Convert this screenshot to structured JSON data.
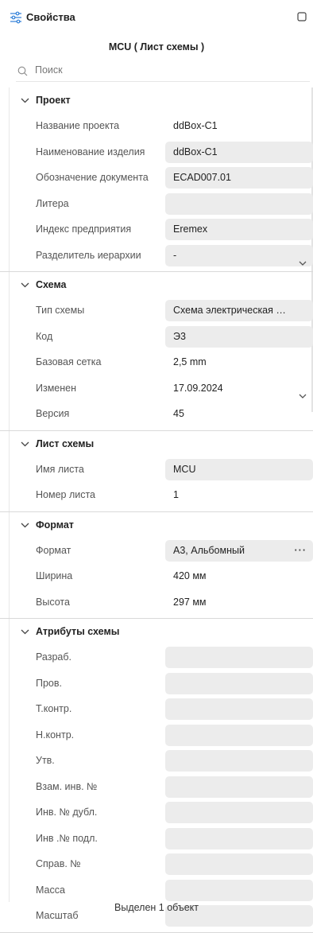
{
  "header": {
    "title": "Свойства",
    "icon": "sliders-icon",
    "pin_icon": "square-icon"
  },
  "sheet_title": "MCU ( Лист схемы )",
  "search": {
    "placeholder": "Поиск",
    "value": ""
  },
  "sections": [
    {
      "title": "Проект",
      "rows": [
        {
          "name": "Название проекта",
          "value": "ddBox-C1",
          "style": "plain"
        },
        {
          "name": "Наименование изделия",
          "value": "ddBox-C1",
          "style": "filled"
        },
        {
          "name": "Обозначение документа",
          "value": "ECAD007.01",
          "style": "filled"
        },
        {
          "name": "Литера",
          "value": "",
          "style": "filled"
        },
        {
          "name": "Индекс предприятия",
          "value": "Eremex",
          "style": "filled"
        },
        {
          "name": "Разделитель иерархии",
          "value": "-",
          "style": "filled",
          "control": "dropdown"
        }
      ]
    },
    {
      "title": "Схема",
      "rows": [
        {
          "name": "Тип схемы",
          "value": "Схема электрическая при...",
          "style": "filled"
        },
        {
          "name": "Код",
          "value": "Э3",
          "style": "filled"
        },
        {
          "name": "Базовая сетка",
          "value": "2,5 mm",
          "style": "plain"
        },
        {
          "name": "Изменен",
          "value": "17.09.2024",
          "style": "plain",
          "control": "dropdown"
        },
        {
          "name": "Версия",
          "value": "45",
          "style": "plain"
        }
      ]
    },
    {
      "title": "Лист схемы",
      "rows": [
        {
          "name": "Имя листа",
          "value": "MCU",
          "style": "filled"
        },
        {
          "name": "Номер листа",
          "value": "1",
          "style": "plain"
        }
      ]
    },
    {
      "title": "Формат",
      "rows": [
        {
          "name": "Формат",
          "value": "А3, Альбомный",
          "style": "filled",
          "control": "ellipsis"
        },
        {
          "name": "Ширина",
          "value": "420 мм",
          "style": "plain"
        },
        {
          "name": "Высота",
          "value": "297 мм",
          "style": "plain"
        }
      ]
    },
    {
      "title": "Атрибуты схемы",
      "rows": [
        {
          "name": "Разраб.",
          "value": "",
          "style": "filled"
        },
        {
          "name": "Пров.",
          "value": "",
          "style": "filled"
        },
        {
          "name": "Т.контр.",
          "value": "",
          "style": "filled"
        },
        {
          "name": "Н.контр.",
          "value": "",
          "style": "filled"
        },
        {
          "name": "Утв.",
          "value": "",
          "style": "filled"
        },
        {
          "name": "Взам. инв. №",
          "value": "",
          "style": "filled"
        },
        {
          "name": "Инв. № дубл.",
          "value": "",
          "style": "filled"
        },
        {
          "name": "Инв .№ подл.",
          "value": "",
          "style": "filled"
        },
        {
          "name": "Справ. №",
          "value": "",
          "style": "filled"
        },
        {
          "name": "Масса",
          "value": "",
          "style": "filled"
        },
        {
          "name": "Масштаб",
          "value": "",
          "style": "filled"
        }
      ]
    }
  ],
  "dots_glyph": "···",
  "footer": "Выделен 1 объект"
}
